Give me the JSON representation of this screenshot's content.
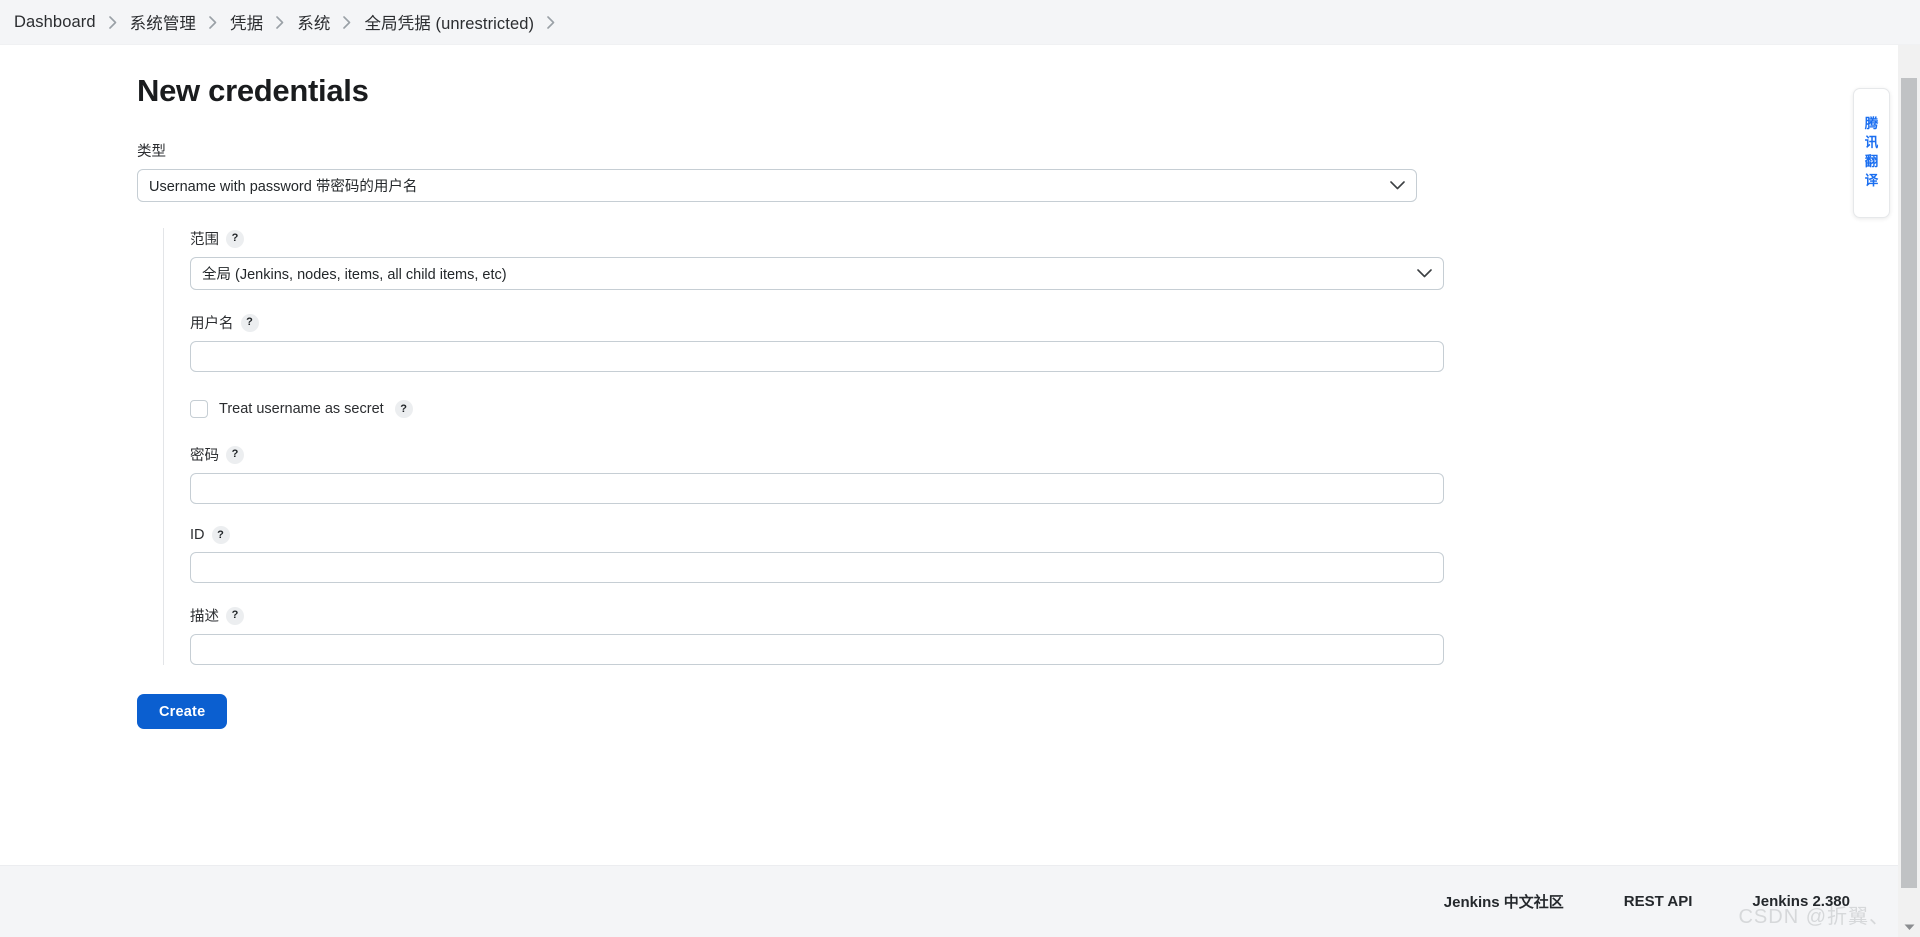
{
  "breadcrumb": {
    "items": [
      {
        "label": "Dashboard"
      },
      {
        "label": "系统管理"
      },
      {
        "label": "凭据"
      },
      {
        "label": "系统"
      },
      {
        "label": "全局凭据 (unrestricted)"
      }
    ],
    "separator": "›"
  },
  "page": {
    "title": "New credentials"
  },
  "form": {
    "type": {
      "label": "类型",
      "value": "Username with password 带密码的用户名"
    },
    "scope": {
      "label": "范围",
      "help": "?",
      "value": "全局 (Jenkins, nodes, items, all child items, etc)"
    },
    "username": {
      "label": "用户名",
      "help": "?",
      "value": "",
      "placeholder": ""
    },
    "secret_checkbox": {
      "label": "Treat username as secret",
      "help": "?",
      "checked": false
    },
    "password": {
      "label": "密码",
      "help": "?",
      "value": "",
      "placeholder": ""
    },
    "id": {
      "label": "ID",
      "help": "?",
      "value": "",
      "placeholder": ""
    },
    "description": {
      "label": "描述",
      "help": "?",
      "value": "",
      "placeholder": ""
    },
    "submit": {
      "label": "Create"
    }
  },
  "footer": {
    "links": [
      {
        "label": "Jenkins 中文社区"
      },
      {
        "label": "REST API"
      }
    ],
    "version": "Jenkins 2.380",
    "watermark": "CSDN @折翼、"
  },
  "translate_widget": {
    "chars": [
      "腾",
      "讯",
      "翻",
      "译"
    ]
  },
  "colors": {
    "accent": "#0b5fd0",
    "breadcrumb_bg": "#f4f5f7",
    "border": "#c6ced4",
    "translate_blue": "#1a6ef0"
  }
}
